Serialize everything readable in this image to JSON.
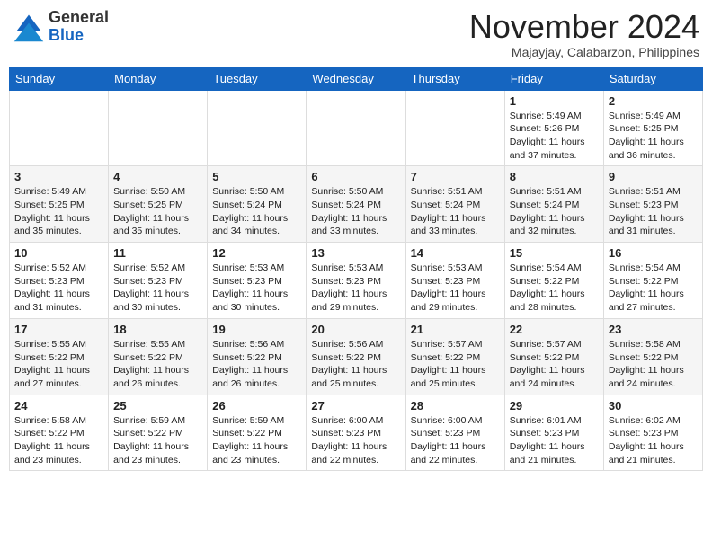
{
  "header": {
    "logo_general": "General",
    "logo_blue": "Blue",
    "month_title": "November 2024",
    "location": "Majayjay, Calabarzon, Philippines"
  },
  "weekdays": [
    "Sunday",
    "Monday",
    "Tuesday",
    "Wednesday",
    "Thursday",
    "Friday",
    "Saturday"
  ],
  "weeks": [
    [
      {
        "day": "",
        "info": ""
      },
      {
        "day": "",
        "info": ""
      },
      {
        "day": "",
        "info": ""
      },
      {
        "day": "",
        "info": ""
      },
      {
        "day": "",
        "info": ""
      },
      {
        "day": "1",
        "info": "Sunrise: 5:49 AM\nSunset: 5:26 PM\nDaylight: 11 hours\nand 37 minutes."
      },
      {
        "day": "2",
        "info": "Sunrise: 5:49 AM\nSunset: 5:25 PM\nDaylight: 11 hours\nand 36 minutes."
      }
    ],
    [
      {
        "day": "3",
        "info": "Sunrise: 5:49 AM\nSunset: 5:25 PM\nDaylight: 11 hours\nand 35 minutes."
      },
      {
        "day": "4",
        "info": "Sunrise: 5:50 AM\nSunset: 5:25 PM\nDaylight: 11 hours\nand 35 minutes."
      },
      {
        "day": "5",
        "info": "Sunrise: 5:50 AM\nSunset: 5:24 PM\nDaylight: 11 hours\nand 34 minutes."
      },
      {
        "day": "6",
        "info": "Sunrise: 5:50 AM\nSunset: 5:24 PM\nDaylight: 11 hours\nand 33 minutes."
      },
      {
        "day": "7",
        "info": "Sunrise: 5:51 AM\nSunset: 5:24 PM\nDaylight: 11 hours\nand 33 minutes."
      },
      {
        "day": "8",
        "info": "Sunrise: 5:51 AM\nSunset: 5:24 PM\nDaylight: 11 hours\nand 32 minutes."
      },
      {
        "day": "9",
        "info": "Sunrise: 5:51 AM\nSunset: 5:23 PM\nDaylight: 11 hours\nand 31 minutes."
      }
    ],
    [
      {
        "day": "10",
        "info": "Sunrise: 5:52 AM\nSunset: 5:23 PM\nDaylight: 11 hours\nand 31 minutes."
      },
      {
        "day": "11",
        "info": "Sunrise: 5:52 AM\nSunset: 5:23 PM\nDaylight: 11 hours\nand 30 minutes."
      },
      {
        "day": "12",
        "info": "Sunrise: 5:53 AM\nSunset: 5:23 PM\nDaylight: 11 hours\nand 30 minutes."
      },
      {
        "day": "13",
        "info": "Sunrise: 5:53 AM\nSunset: 5:23 PM\nDaylight: 11 hours\nand 29 minutes."
      },
      {
        "day": "14",
        "info": "Sunrise: 5:53 AM\nSunset: 5:23 PM\nDaylight: 11 hours\nand 29 minutes."
      },
      {
        "day": "15",
        "info": "Sunrise: 5:54 AM\nSunset: 5:22 PM\nDaylight: 11 hours\nand 28 minutes."
      },
      {
        "day": "16",
        "info": "Sunrise: 5:54 AM\nSunset: 5:22 PM\nDaylight: 11 hours\nand 27 minutes."
      }
    ],
    [
      {
        "day": "17",
        "info": "Sunrise: 5:55 AM\nSunset: 5:22 PM\nDaylight: 11 hours\nand 27 minutes."
      },
      {
        "day": "18",
        "info": "Sunrise: 5:55 AM\nSunset: 5:22 PM\nDaylight: 11 hours\nand 26 minutes."
      },
      {
        "day": "19",
        "info": "Sunrise: 5:56 AM\nSunset: 5:22 PM\nDaylight: 11 hours\nand 26 minutes."
      },
      {
        "day": "20",
        "info": "Sunrise: 5:56 AM\nSunset: 5:22 PM\nDaylight: 11 hours\nand 25 minutes."
      },
      {
        "day": "21",
        "info": "Sunrise: 5:57 AM\nSunset: 5:22 PM\nDaylight: 11 hours\nand 25 minutes."
      },
      {
        "day": "22",
        "info": "Sunrise: 5:57 AM\nSunset: 5:22 PM\nDaylight: 11 hours\nand 24 minutes."
      },
      {
        "day": "23",
        "info": "Sunrise: 5:58 AM\nSunset: 5:22 PM\nDaylight: 11 hours\nand 24 minutes."
      }
    ],
    [
      {
        "day": "24",
        "info": "Sunrise: 5:58 AM\nSunset: 5:22 PM\nDaylight: 11 hours\nand 23 minutes."
      },
      {
        "day": "25",
        "info": "Sunrise: 5:59 AM\nSunset: 5:22 PM\nDaylight: 11 hours\nand 23 minutes."
      },
      {
        "day": "26",
        "info": "Sunrise: 5:59 AM\nSunset: 5:22 PM\nDaylight: 11 hours\nand 23 minutes."
      },
      {
        "day": "27",
        "info": "Sunrise: 6:00 AM\nSunset: 5:23 PM\nDaylight: 11 hours\nand 22 minutes."
      },
      {
        "day": "28",
        "info": "Sunrise: 6:00 AM\nSunset: 5:23 PM\nDaylight: 11 hours\nand 22 minutes."
      },
      {
        "day": "29",
        "info": "Sunrise: 6:01 AM\nSunset: 5:23 PM\nDaylight: 11 hours\nand 21 minutes."
      },
      {
        "day": "30",
        "info": "Sunrise: 6:02 AM\nSunset: 5:23 PM\nDaylight: 11 hours\nand 21 minutes."
      }
    ]
  ]
}
